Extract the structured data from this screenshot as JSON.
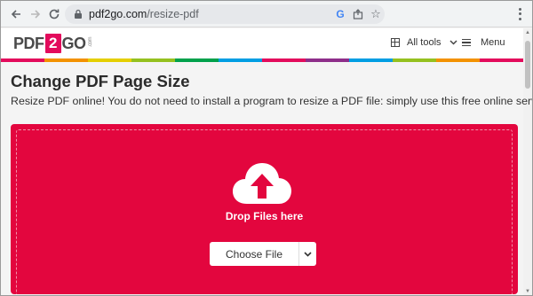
{
  "browser": {
    "url_domain": "pdf2go.com",
    "url_path": "/resize-pdf"
  },
  "site": {
    "logo": {
      "part1": "PDF",
      "part2": "2",
      "part3": "GO",
      "suffix": ".com"
    },
    "nav": {
      "all_tools": "All tools",
      "menu": "Menu"
    },
    "rainbow_colors": [
      "#e30b5c",
      "#f39200",
      "#e5cf00",
      "#95c11f",
      "#00a14b",
      "#009ee3",
      "#e30b5c",
      "#8e2e8a",
      "#009ee3",
      "#95c11f",
      "#f39200",
      "#e30b5c"
    ]
  },
  "main": {
    "title": "Change PDF Page Size",
    "description": "Resize PDF online! You do not need to install a program to resize a PDF file: simply use this free online service."
  },
  "upload": {
    "drop_label": "Drop Files here",
    "choose_button": "Choose File",
    "accent": "#e3063e"
  }
}
